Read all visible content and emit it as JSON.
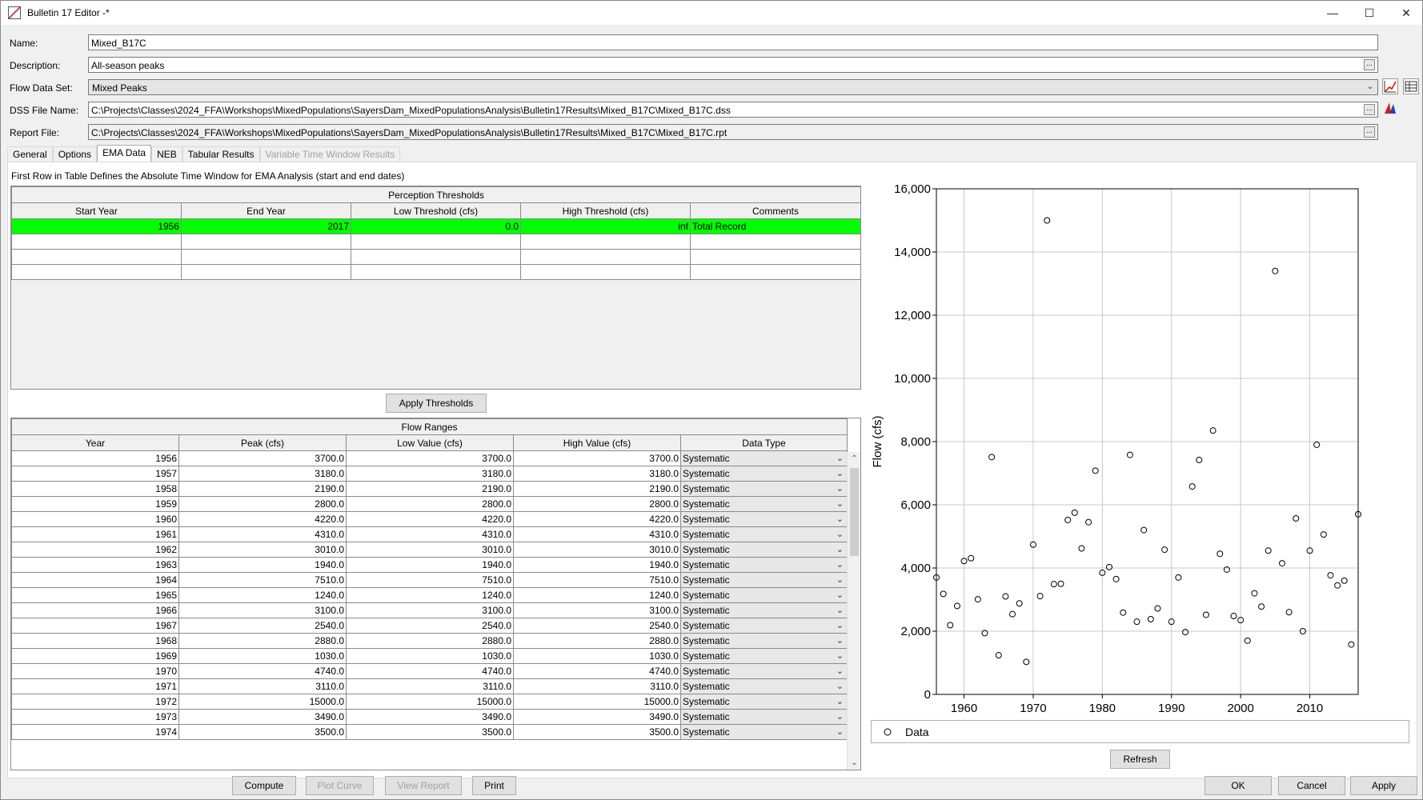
{
  "window": {
    "title": "Bulletin 17 Editor -*"
  },
  "form": {
    "name_label": "Name:",
    "name_value": "Mixed_B17C",
    "description_label": "Description:",
    "description_value": "All-season peaks",
    "flow_label": "Flow Data Set:",
    "flow_value": "Mixed Peaks",
    "dss_label": "DSS File Name:",
    "dss_value": "C:\\Projects\\Classes\\2024_FFA\\Workshops\\MixedPopulations\\SayersDam_MixedPopulationsAnalysis\\Bulletin17Results\\Mixed_B17C\\Mixed_B17C.dss",
    "report_label": "Report File:",
    "report_value": "C:\\Projects\\Classes\\2024_FFA\\Workshops\\MixedPopulations\\SayersDam_MixedPopulationsAnalysis\\Bulletin17Results\\Mixed_B17C\\Mixed_B17C.rpt",
    "dots": "..."
  },
  "tabs": [
    "General",
    "Options",
    "EMA Data",
    "NEB",
    "Tabular Results",
    "Variable Time Window Results"
  ],
  "caption": "First Row in Table Defines the Absolute Time Window for EMA Analysis (start and end dates)",
  "thresholds": {
    "title": "Perception Thresholds",
    "headers": [
      "Start Year",
      "End Year",
      "Low Threshold (cfs)",
      "High Threshold (cfs)",
      "Comments"
    ],
    "rows": [
      [
        "1956",
        "2017",
        "0.0",
        "inf",
        "Total Record"
      ],
      [
        "",
        "",
        "",
        "",
        ""
      ],
      [
        "",
        "",
        "",
        "",
        ""
      ],
      [
        "",
        "",
        "",
        "",
        ""
      ]
    ],
    "apply_label": "Apply Thresholds"
  },
  "flow_ranges": {
    "title": "Flow Ranges",
    "headers": [
      "Year",
      "Peak (cfs)",
      "Low Value (cfs)",
      "High Value (cfs)",
      "Data Type"
    ],
    "rows": [
      [
        "1956",
        "3700.0",
        "3700.0",
        "3700.0",
        "Systematic"
      ],
      [
        "1957",
        "3180.0",
        "3180.0",
        "3180.0",
        "Systematic"
      ],
      [
        "1958",
        "2190.0",
        "2190.0",
        "2190.0",
        "Systematic"
      ],
      [
        "1959",
        "2800.0",
        "2800.0",
        "2800.0",
        "Systematic"
      ],
      [
        "1960",
        "4220.0",
        "4220.0",
        "4220.0",
        "Systematic"
      ],
      [
        "1961",
        "4310.0",
        "4310.0",
        "4310.0",
        "Systematic"
      ],
      [
        "1962",
        "3010.0",
        "3010.0",
        "3010.0",
        "Systematic"
      ],
      [
        "1963",
        "1940.0",
        "1940.0",
        "1940.0",
        "Systematic"
      ],
      [
        "1964",
        "7510.0",
        "7510.0",
        "7510.0",
        "Systematic"
      ],
      [
        "1965",
        "1240.0",
        "1240.0",
        "1240.0",
        "Systematic"
      ],
      [
        "1966",
        "3100.0",
        "3100.0",
        "3100.0",
        "Systematic"
      ],
      [
        "1967",
        "2540.0",
        "2540.0",
        "2540.0",
        "Systematic"
      ],
      [
        "1968",
        "2880.0",
        "2880.0",
        "2880.0",
        "Systematic"
      ],
      [
        "1969",
        "1030.0",
        "1030.0",
        "1030.0",
        "Systematic"
      ],
      [
        "1970",
        "4740.0",
        "4740.0",
        "4740.0",
        "Systematic"
      ],
      [
        "1971",
        "3110.0",
        "3110.0",
        "3110.0",
        "Systematic"
      ],
      [
        "1972",
        "15000.0",
        "15000.0",
        "15000.0",
        "Systematic"
      ],
      [
        "1973",
        "3490.0",
        "3490.0",
        "3490.0",
        "Systematic"
      ],
      [
        "1974",
        "3500.0",
        "3500.0",
        "3500.0",
        "Systematic"
      ]
    ]
  },
  "buttons": {
    "compute": "Compute",
    "plot_curve": "Plot Curve",
    "view_report": "View Report",
    "print": "Print",
    "refresh": "Refresh",
    "ok": "OK",
    "cancel": "Cancel",
    "apply": "Apply"
  },
  "chart_data": {
    "type": "scatter",
    "ylabel": "Flow (cfs)",
    "xlabel": "",
    "xlim": [
      1956,
      2017
    ],
    "ylim": [
      0,
      16000
    ],
    "x_ticks": [
      1960,
      1970,
      1980,
      1990,
      2000,
      2010
    ],
    "y_ticks": [
      0,
      2000,
      4000,
      6000,
      8000,
      10000,
      12000,
      14000,
      16000
    ],
    "y_tick_labels": [
      "0",
      "2,000",
      "4,000",
      "6,000",
      "8,000",
      "10,000",
      "12,000",
      "14,000",
      "16,000"
    ],
    "grid": true,
    "legend_position": "bottom",
    "series": [
      {
        "name": "Data",
        "marker": "open-circle",
        "color": "#000000",
        "points": [
          [
            1956,
            3700
          ],
          [
            1957,
            3180
          ],
          [
            1958,
            2190
          ],
          [
            1959,
            2800
          ],
          [
            1960,
            4220
          ],
          [
            1961,
            4310
          ],
          [
            1962,
            3010
          ],
          [
            1963,
            1940
          ],
          [
            1964,
            7510
          ],
          [
            1965,
            1240
          ],
          [
            1966,
            3100
          ],
          [
            1967,
            2540
          ],
          [
            1968,
            2880
          ],
          [
            1969,
            1030
          ],
          [
            1970,
            4740
          ],
          [
            1971,
            3110
          ],
          [
            1972,
            15000
          ],
          [
            1973,
            3490
          ],
          [
            1974,
            3500
          ],
          [
            1975,
            5520
          ],
          [
            1976,
            5750
          ],
          [
            1977,
            4620
          ],
          [
            1978,
            5450
          ],
          [
            1979,
            7080
          ],
          [
            1980,
            3850
          ],
          [
            1981,
            4030
          ],
          [
            1982,
            3650
          ],
          [
            1983,
            2590
          ],
          [
            1984,
            7580
          ],
          [
            1985,
            2300
          ],
          [
            1986,
            5200
          ],
          [
            1987,
            2380
          ],
          [
            1988,
            2720
          ],
          [
            1989,
            4580
          ],
          [
            1990,
            2300
          ],
          [
            1991,
            3700
          ],
          [
            1992,
            1970
          ],
          [
            1993,
            6580
          ],
          [
            1994,
            7420
          ],
          [
            1995,
            2520
          ],
          [
            1996,
            8350
          ],
          [
            1997,
            4450
          ],
          [
            1998,
            3950
          ],
          [
            1999,
            2480
          ],
          [
            2000,
            2350
          ],
          [
            2001,
            1700
          ],
          [
            2002,
            3200
          ],
          [
            2003,
            2780
          ],
          [
            2004,
            4550
          ],
          [
            2005,
            13400
          ],
          [
            2006,
            4150
          ],
          [
            2007,
            2600
          ],
          [
            2008,
            5570
          ],
          [
            2009,
            2000
          ],
          [
            2010,
            4550
          ],
          [
            2011,
            7900
          ],
          [
            2012,
            5060
          ],
          [
            2013,
            3770
          ],
          [
            2014,
            3450
          ],
          [
            2015,
            3600
          ],
          [
            2016,
            1580
          ],
          [
            2017,
            5700
          ]
        ]
      }
    ]
  },
  "colors": {
    "selected_row": "#00ff00",
    "grid_line": "#c8c8c8"
  }
}
